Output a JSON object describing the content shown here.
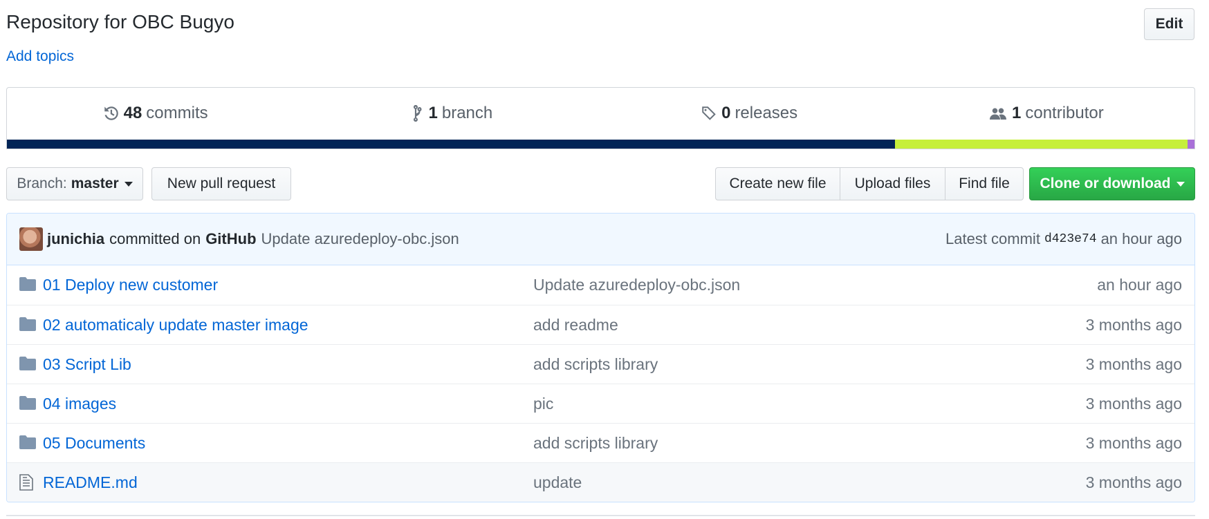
{
  "repo": {
    "description": "Repository for OBC Bugyo",
    "edit_label": "Edit",
    "topics_label": "Add topics"
  },
  "summary": {
    "commits": {
      "count": "48",
      "label": "commits",
      "icon": "history-icon"
    },
    "branches": {
      "count": "1",
      "label": "branch",
      "icon": "git-branch-icon"
    },
    "releases": {
      "count": "0",
      "label": "releases",
      "icon": "tag-icon"
    },
    "contributors": {
      "count": "1",
      "label": "contributor",
      "icon": "people-icon"
    }
  },
  "language_bar": [
    {
      "color": "#012456",
      "percent": 74.8
    },
    {
      "color": "#c6ef3b",
      "percent": 24.6
    },
    {
      "color": "#a970d8",
      "percent": 0.6
    }
  ],
  "toolbar": {
    "branch_prefix": "Branch:",
    "branch_name": "master",
    "new_pr": "New pull request",
    "create_file": "Create new file",
    "upload_files": "Upload files",
    "find_file": "Find file",
    "clone": "Clone or download"
  },
  "latest_commit": {
    "author": "junichia",
    "committed_on": "committed on",
    "platform": "GitHub",
    "message": "Update azuredeploy-obc.json",
    "latest_label": "Latest commit",
    "sha": "d423e74",
    "age": "an hour ago"
  },
  "files": [
    {
      "name": "01 Deploy new customer",
      "type": "folder",
      "message": "Update azuredeploy-obc.json",
      "age": "an hour ago"
    },
    {
      "name": "02 automaticaly update master image",
      "type": "folder",
      "message": "add readme",
      "age": "3 months ago"
    },
    {
      "name": "03 Script Lib",
      "type": "folder",
      "message": "add scripts library",
      "age": "3 months ago"
    },
    {
      "name": "04 images",
      "type": "folder",
      "message": "pic",
      "age": "3 months ago"
    },
    {
      "name": "05 Documents",
      "type": "folder",
      "message": "add scripts library",
      "age": "3 months ago"
    },
    {
      "name": "README.md",
      "type": "file",
      "message": "update",
      "age": "3 months ago"
    }
  ],
  "colors": {
    "link": "#0366d6",
    "clone_button": "#28a745",
    "commit_tease_bg": "#f1f8ff"
  }
}
